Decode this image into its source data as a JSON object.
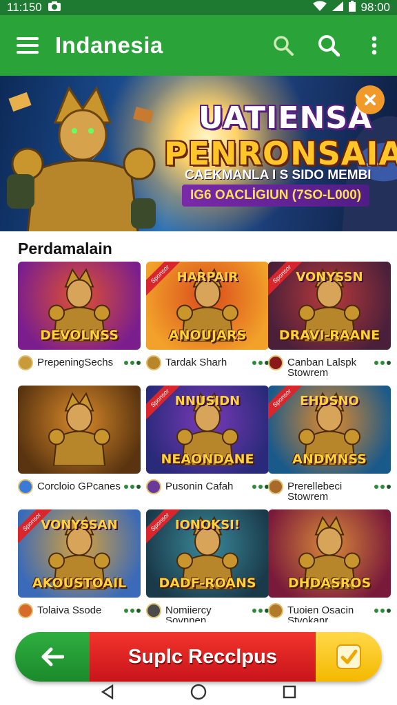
{
  "status_bar": {
    "time": "11:150",
    "right_text": "98:00",
    "icons": [
      "camera-icon",
      "wifi-icon",
      "signal-icon",
      "battery-icon"
    ]
  },
  "app_bar": {
    "title": "Indanesia",
    "icons": [
      "menu-icon",
      "search-icon",
      "search-icon",
      "more-vert-icon"
    ]
  },
  "banner": {
    "title_line1": "UATIENSA",
    "title_line2": "PENRONSAIA",
    "subtitle": "CAEKMANLA I S SIDO MEMBI",
    "pill": "IG6 OACLİGIUN (7SO-L000)",
    "close_icon": "close-icon"
  },
  "section": {
    "title": "Perdamalain"
  },
  "games": [
    {
      "name": "PrepeningSechs",
      "thumb_text": "DEVOLNSS",
      "top_text": "",
      "ribbon": "",
      "colors": [
        "#7a1e8e",
        "#e0512f"
      ],
      "icon_color": "#c89a3a"
    },
    {
      "name": "Tardak Sharh",
      "thumb_text": "ANOUJARS",
      "top_text": "HARPAIR",
      "ribbon": "Sponsor",
      "colors": [
        "#f2a12a",
        "#d94a1c"
      ],
      "icon_color": "#b8862a"
    },
    {
      "name": "Canban Lalspk\nStowrem",
      "thumb_text": "DRAVI-RAANE",
      "top_text": "VONYSSN",
      "ribbon": "Sponsor",
      "colors": [
        "#4a1f3a",
        "#b83a3a"
      ],
      "icon_color": "#8a1a1a"
    },
    {
      "name": "Corcloio GPcanes",
      "thumb_text": "",
      "top_text": "",
      "ribbon": "",
      "colors": [
        "#5a3410",
        "#d98a2a"
      ],
      "icon_color": "#3a7ad8"
    },
    {
      "name": "Pusonin Cafah",
      "thumb_text": "NEAONDANE",
      "top_text": "NNUSIDN",
      "ribbon": "Sponsor",
      "colors": [
        "#2a2a7a",
        "#7a3ab8"
      ],
      "icon_color": "#6a3a9a"
    },
    {
      "name": "Prerellebeci\nStowrem",
      "thumb_text": "ANDMNSS",
      "top_text": "EHDSNO",
      "ribbon": "Sponsor",
      "colors": [
        "#1a5a8a",
        "#e28a2a"
      ],
      "icon_color": "#a86a2a"
    },
    {
      "name": "Tolaiva Ssode",
      "thumb_text": "AKOUSTOAIL",
      "top_text": "VONYSSAN",
      "ribbon": "Sponsor",
      "colors": [
        "#3a6ab8",
        "#d8a23a"
      ],
      "icon_color": "#d86a2a"
    },
    {
      "name": "Nomiiercy\nSovnnen",
      "thumb_text": "DADF-ROANS",
      "top_text": "IONOKSI!",
      "ribbon": "Sponsor",
      "colors": [
        "#1a3a4a",
        "#3a8a9a"
      ],
      "icon_color": "#4a4a4a"
    },
    {
      "name": "Tuoien Osacin\nStvokanr",
      "thumb_text": "DHDASROS",
      "top_text": "",
      "ribbon": "",
      "colors": [
        "#7a1a3a",
        "#d88a3a"
      ],
      "icon_color": "#b07a2a"
    }
  ],
  "cta": {
    "label": "Suplc Recclpus",
    "back_icon": "arrow-left-icon",
    "confirm_icon": "checkbox-icon",
    "colors": {
      "back": "#22a035",
      "mid": "#e5231f",
      "confirm": "#f8c41c"
    }
  },
  "nav": {
    "icons": [
      "back-triangle-icon",
      "home-circle-icon",
      "recents-square-icon"
    ]
  },
  "colors": {
    "app_bar": "#2aa338",
    "status_bar": "#1e7a30"
  }
}
